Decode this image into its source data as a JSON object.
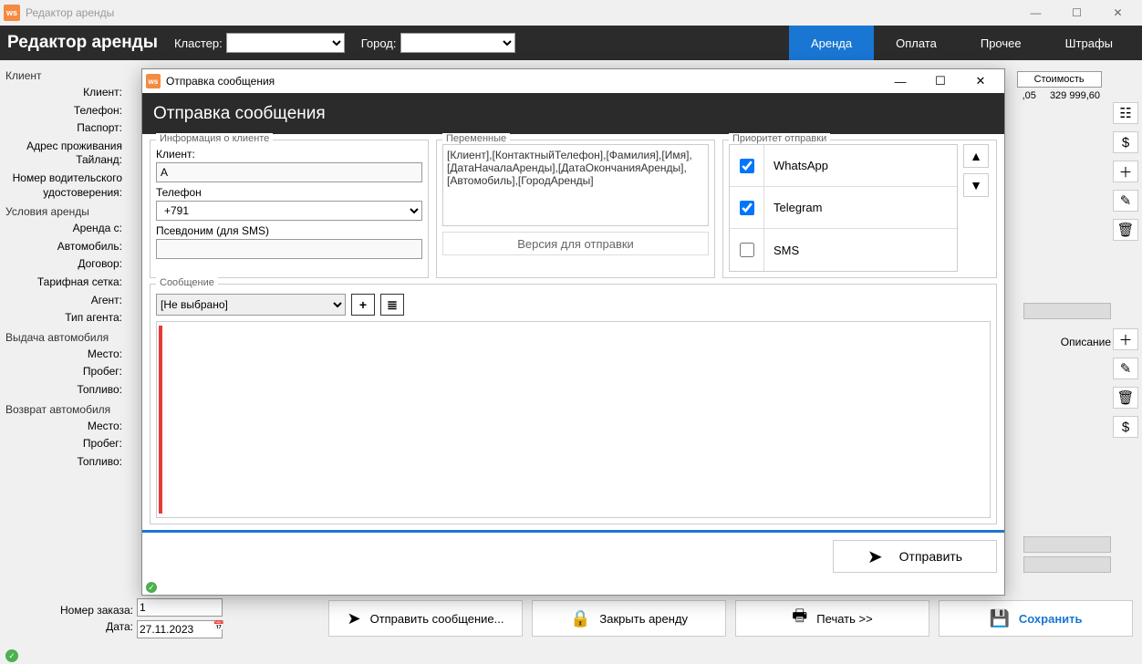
{
  "titlebar": {
    "ws": "ws",
    "title": "Редактор аренды"
  },
  "toolbar": {
    "title": "Редактор аренды",
    "cluster_label": "Кластер:",
    "city_label": "Город:",
    "tabs": [
      "Аренда",
      "Оплата",
      "Прочее",
      "Штрафы"
    ]
  },
  "left": {
    "g1": "Клиент",
    "g1_rows": [
      "Клиент:",
      "Телефон:",
      "Паспорт:",
      "Адрес проживания Тайланд:",
      "Номер водительского удостоверения:"
    ],
    "g2": "Условия аренды",
    "g2_rows": [
      "Аренда с:",
      "Автомобиль:",
      "Договор:",
      "Тарифная сетка:",
      "Агент:",
      "Тип агента:"
    ],
    "g3": "Выдача автомобиля",
    "g3_rows": [
      "Место:",
      "Пробег:",
      "Топливо:"
    ],
    "g4": "Возврат автомобиля",
    "g4_rows": [
      "Место:",
      "Пробег:",
      "Топливо:"
    ]
  },
  "cost": {
    "header": "Стоимость",
    "v1": ",05",
    "v2": "329 999,60"
  },
  "desc_label": "Описание",
  "bottom": {
    "order_label": "Номер заказа:",
    "date_label": "Дата:",
    "order_value": "1",
    "date_value": "27.11.2023",
    "btn_send": "Отправить сообщение...",
    "btn_close": "Закрыть аренду",
    "btn_print": "Печать   >>",
    "btn_save": "Сохранить"
  },
  "modal": {
    "titlebar": "Отправка сообщения",
    "header": "Отправка сообщения",
    "client_group": "Информация о клиенте",
    "client_label": "Клиент:",
    "client_value": "А",
    "phone_label": "Телефон",
    "phone_value": "+791",
    "alias_label": "Псевдоним (для SMS)",
    "vars_group": "Переменные",
    "vars_text": "[Клиент],[КонтактныйТелефон],[Фамилия],[Имя],[ДатаНачалаАренды],[ДатаОкончанияАренды],[Автомобиль],[ГородАренды]",
    "version_btn": "Версия для отправки",
    "prio_group": "Приоритет отправки",
    "prio": [
      {
        "name": "WhatsApp",
        "checked": true
      },
      {
        "name": "Telegram",
        "checked": true
      },
      {
        "name": "SMS",
        "checked": false
      }
    ],
    "msg_group": "Сообщение",
    "template_select": "[Не выбрано]",
    "send_btn": "Отправить"
  }
}
